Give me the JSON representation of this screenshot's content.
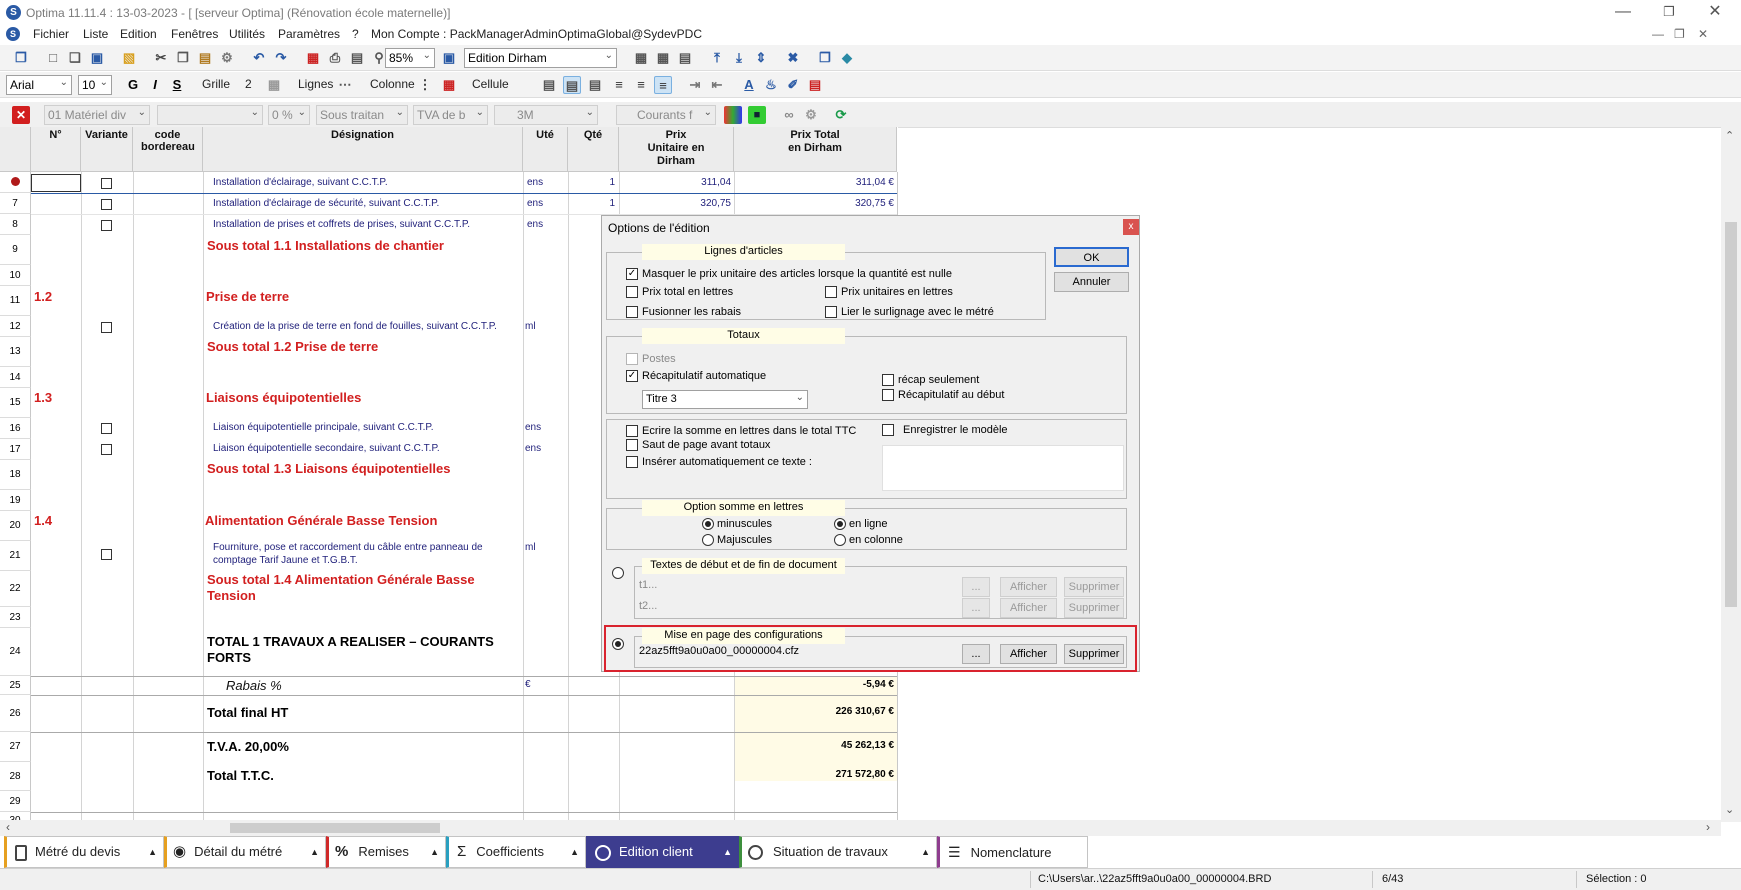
{
  "window": {
    "title": "Optima 11.11.4 : 13-03-2023 - [ [serveur Optima] (Rénovation école maternelle)]"
  },
  "menu": {
    "items": [
      "Fichier",
      "Liste",
      "Edition",
      "Fenêtres",
      "Utilités",
      "Paramètres",
      "?"
    ],
    "account": "Mon Compte : PackManagerAdminOptimaGlobal@SydevPDC"
  },
  "toolbar1": {
    "zoom": "85%",
    "edition": "Edition Dirham"
  },
  "toolbar2": {
    "font": "Arial",
    "size": "10",
    "bold": "G",
    "italic": "I",
    "strike": "S",
    "grille": "Grille",
    "grille_val": "2",
    "lignes": "Lignes",
    "colonne": "Colonne",
    "cellule": "Cellule",
    "font_color_glyph": "A"
  },
  "toolbar3": {
    "filter1": "01  Matériel div",
    "filter3": "0 %",
    "filter4": "Sous traitan",
    "filter5": "TVA de b",
    "filter6": "3M",
    "filter7": "Courants f"
  },
  "grid": {
    "headers": {
      "n": "N°",
      "variante": "Variante",
      "code": "code bordereau",
      "designation": "Désignation",
      "ute": "Uté",
      "qte": "Qté",
      "pu": "Prix Unitaire en Dirham",
      "pt": "Prix Total en Dirham"
    },
    "row_numbers": [
      "",
      "7",
      "8",
      "9",
      "10",
      "11",
      "12",
      "13",
      "14",
      "15",
      "16",
      "17",
      "18",
      "19",
      "20",
      "21",
      "22",
      "23",
      "24",
      "25",
      "26",
      "27",
      "28",
      "29",
      "30"
    ],
    "r1": {
      "designation": "Installation d'éclairage, suivant C.C.T.P.",
      "ute": "ens",
      "qte": "1",
      "pu": "311,04",
      "pt": "311,04 €"
    },
    "r7": {
      "designation": "Installation d'éclairage de sécurité, suivant C.C.T.P.",
      "ute": "ens",
      "qte": "1",
      "pu": "320,75",
      "pt": "320,75 €"
    },
    "r8": {
      "designation": "Installation de prises et coffrets de prises, suivant C.C.T.P.",
      "ute": "ens"
    },
    "st11": "Sous total 1.1 Installations de chantier",
    "n12": "1.2",
    "t12": "Prise de terre",
    "r12": {
      "designation": "Création de la prise de terre en fond de fouilles, suivant C.C.T.P.",
      "ute": "ml"
    },
    "st12": "Sous total 1.2 Prise de terre",
    "n13": "1.3",
    "t13": "Liaisons équipotentielles",
    "r16": {
      "designation": "Liaison équipotentielle principale, suivant C.C.T.P.",
      "ute": "ens"
    },
    "r17": {
      "designation": "Liaison équipotentielle secondaire, suivant C.C.T.P.",
      "ute": "ens"
    },
    "st13": "Sous total 1.3 Liaisons équipotentielles",
    "n14": "1.4",
    "t14": "Alimentation Générale Basse Tension",
    "r21": {
      "designation_l1": "Fourniture, pose et raccordement du câble entre panneau de",
      "designation_l2": "comptage Tarif Jaune et T.G.B.T.",
      "ute": "ml"
    },
    "st14_l1": "Sous total 1.4 Alimentation Générale Basse",
    "st14_l2": "Tension",
    "total1_l1": "TOTAL 1 TRAVAUX A REALISER – COURANTS",
    "total1_l2": "FORTS",
    "rabais": {
      "label": "Rabais %",
      "ute": "€",
      "pt": "-5,94 €"
    },
    "ht": {
      "label": "Total final HT",
      "pt": "226 310,67 €"
    },
    "tva": {
      "label": "T.V.A. 20,00%",
      "pt": "45 262,13 €"
    },
    "ttc": {
      "label": "Total  T.T.C.",
      "pt": "271 572,80 €"
    }
  },
  "dialog": {
    "title": "Options de l'édition",
    "close": "x",
    "ok": "OK",
    "cancel": "Annuler",
    "g1": {
      "title": "Lignes d'articles",
      "masquer": "Masquer le prix unitaire des articles lorsque la quantité est nulle",
      "prix_total_lettres": "Prix total en lettres",
      "prix_unit_lettres": "Prix unitaires en lettres",
      "fusionner": "Fusionner les rabais",
      "lier": "Lier le surlignage avec le métré"
    },
    "g2": {
      "title": "Totaux",
      "postes": "Postes",
      "recap_auto": "Récapitulatif automatique",
      "titre": "Titre 3",
      "recap_seul": "récap seulement",
      "recap_debut": "Récapitulatif au début"
    },
    "g3": {
      "ecrire": "Ecrire la somme en lettres dans le total TTC",
      "saut": "Saut de page avant totaux",
      "inserer": "Insérer automatiquement ce texte :",
      "enregistrer": "Enregistrer le modèle"
    },
    "g4": {
      "title": "Option somme en lettres",
      "minuscules": "minuscules",
      "majuscules": "Majuscules",
      "en_ligne": "en ligne",
      "en_colonne": "en colonne"
    },
    "g5": {
      "title": "Textes de début et de fin de document",
      "t1": "t1...",
      "t2": "t2...",
      "dots": "...",
      "afficher": "Afficher",
      "supprimer": "Supprimer"
    },
    "g6": {
      "title": "Mise en page des configurations",
      "file": "22az5fft9a0u0a00_00000004.cfz",
      "dots": "...",
      "afficher": "Afficher",
      "supprimer": "Supprimer"
    }
  },
  "tabs": [
    {
      "label": "Métré du devis"
    },
    {
      "label": "Détail du métré"
    },
    {
      "label": "Remises"
    },
    {
      "label": "Coefficients"
    },
    {
      "label": "Edition client"
    },
    {
      "label": "Situation de travaux"
    },
    {
      "label": "Nomenclature"
    }
  ],
  "status": {
    "path": "C:\\Users\\ar..\\22az5fft9a0u0a00_00000004.BRD",
    "page": "6/43",
    "selection": "Sélection : 0"
  },
  "colors": {
    "accent_tab": "#3d3d8f",
    "red": "#d21f1f",
    "highlight_border": "#d9232e"
  }
}
